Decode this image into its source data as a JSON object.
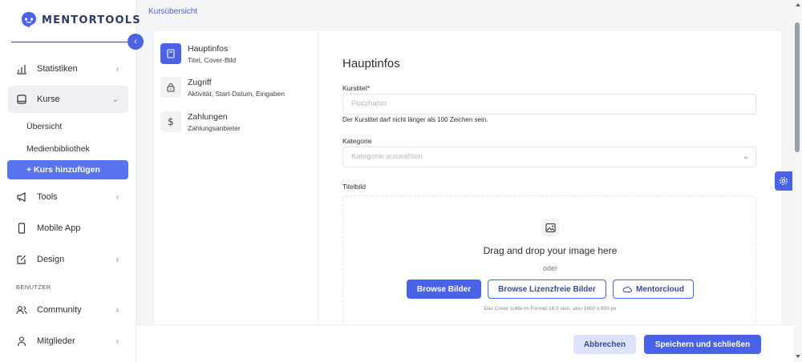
{
  "app": {
    "logo_text": "MENTORTOOLS",
    "accent_color": "#4a63e6"
  },
  "sidebar": {
    "items": [
      {
        "label": "Statistiken",
        "icon": "bar-chart-icon",
        "has_chevron": true
      },
      {
        "label": "Kurse",
        "icon": "book-icon",
        "has_chevron": true,
        "expanded": true
      },
      {
        "label": "Tools",
        "icon": "megaphone-icon",
        "has_chevron": true
      },
      {
        "label": "Mobile App",
        "icon": "phone-icon",
        "has_chevron": false
      },
      {
        "label": "Design",
        "icon": "edit-icon",
        "has_chevron": true
      },
      {
        "label": "Community",
        "icon": "users-icon",
        "has_chevron": true
      },
      {
        "label": "Mitglieder",
        "icon": "user-icon",
        "has_chevron": true
      }
    ],
    "sub_items": [
      "Übersicht",
      "Medienbibliothek",
      "+ Kurs hinzufügen"
    ],
    "section_label": "BENUTZER"
  },
  "breadcrumb": "Kursübersicht",
  "steps": [
    {
      "title": "Hauptinfos",
      "subtitle": "Titel, Cover-Bild",
      "icon": "book-icon",
      "active": true
    },
    {
      "title": "Zugriff",
      "subtitle": "Aktivität, Start-Datum, Eingaben",
      "icon": "lock-icon",
      "active": false
    },
    {
      "title": "Zahlungen",
      "subtitle": "Zahlungsanbieter",
      "icon": "dollar-icon",
      "active": false
    }
  ],
  "form": {
    "title": "Hauptinfos",
    "course_title_label": "Kurstitel*",
    "course_title_placeholder": "Platzhalter",
    "course_title_hint": "Der Kurstitel darf nicht länger als 100 Zeichen sein.",
    "category_label": "Kategorie",
    "category_placeholder": "Kategorie auswählen",
    "cover_label": "Titelbild",
    "dropzone_title": "Drag and drop your image here",
    "dropzone_or": "oder",
    "browse_images": "Browse Bilder",
    "browse_free_images": "Browse Lizenzfreie Bilder",
    "mentorcloud": "Mentorcloud",
    "cover_note": "Das Cover sollte im Format 16:9 sein, also 1600 x 900 px"
  },
  "footer": {
    "cancel_label": "Abbrechen",
    "save_label": "Speichern und schließen"
  }
}
